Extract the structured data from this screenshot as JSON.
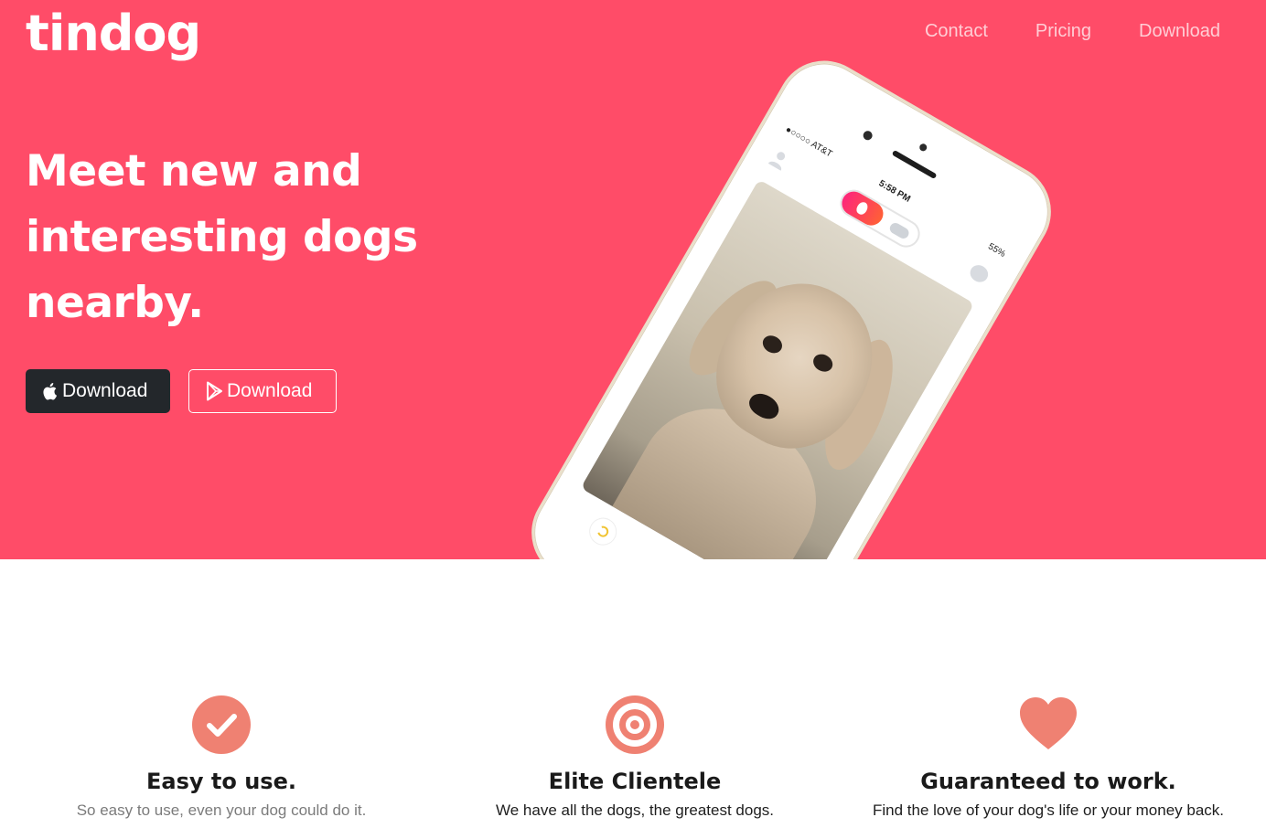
{
  "brand": {
    "name": "tindog"
  },
  "nav": {
    "items": [
      "Contact",
      "Pricing",
      "Download"
    ]
  },
  "hero": {
    "headline": "Meet new and interesting dogs nearby.",
    "buttons": {
      "apple": "Download",
      "play": "Download"
    }
  },
  "phone": {
    "carrier": "●○○○○ AT&T",
    "time": "5:58 PM",
    "battery": "55%"
  },
  "features": [
    {
      "icon": "check-circle-icon",
      "title": "Easy to use.",
      "text": "So easy to use, even your dog could do it."
    },
    {
      "icon": "bullseye-icon",
      "title": "Elite Clientele",
      "text": "We have all the dogs, the greatest dogs."
    },
    {
      "icon": "heart-icon",
      "title": "Guaranteed to work.",
      "text": "Find the love of your dog's life or your money back."
    }
  ],
  "colors": {
    "brand": "#ff4c68",
    "accent": "#ef8172",
    "dark": "#23272b"
  }
}
